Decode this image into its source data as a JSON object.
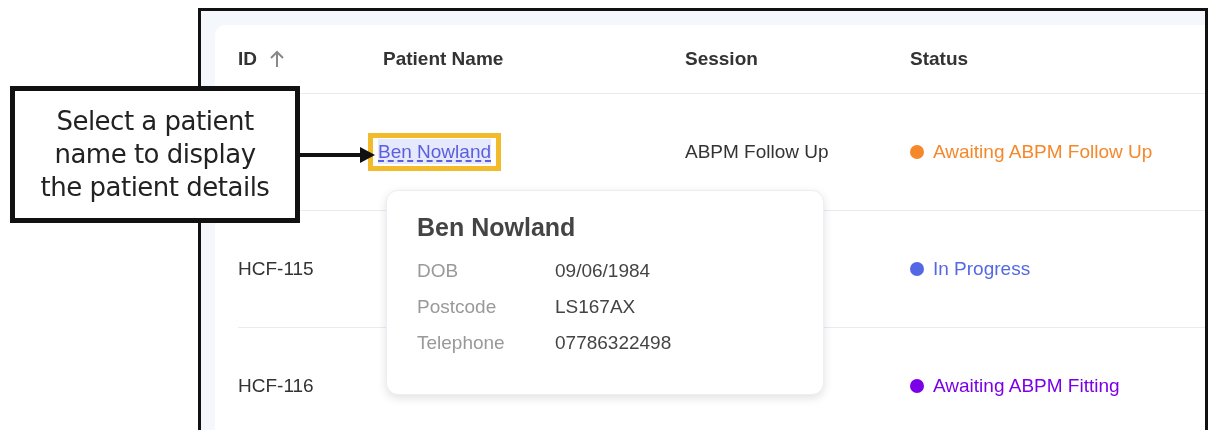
{
  "table": {
    "columns": [
      {
        "label": "ID",
        "sorted_ascending": true
      },
      {
        "label": "Patient Name"
      },
      {
        "label": "Session"
      },
      {
        "label": "Status"
      }
    ],
    "rows": [
      {
        "patient_name": "Ben Nowland",
        "highlighted": true,
        "session": "ABPM Follow Up",
        "status": "Awaiting ABPM Follow Up",
        "color": "#f5882a"
      },
      {
        "id": "HCF-115",
        "status": "In Progress",
        "color": "#5468e6"
      },
      {
        "id": "HCF-116",
        "status": "Awaiting ABPM Fitting",
        "color": "#7b00e8"
      }
    ]
  },
  "popup": {
    "title": "Ben Nowland",
    "fields": [
      {
        "label": "DOB",
        "value": "09/06/1984"
      },
      {
        "label": "Postcode",
        "value": "LS167AX"
      },
      {
        "label": "Telephone",
        "value": "07786322498"
      }
    ]
  },
  "callout": {
    "text": "Select a patient\nname to display\nthe patient details"
  }
}
